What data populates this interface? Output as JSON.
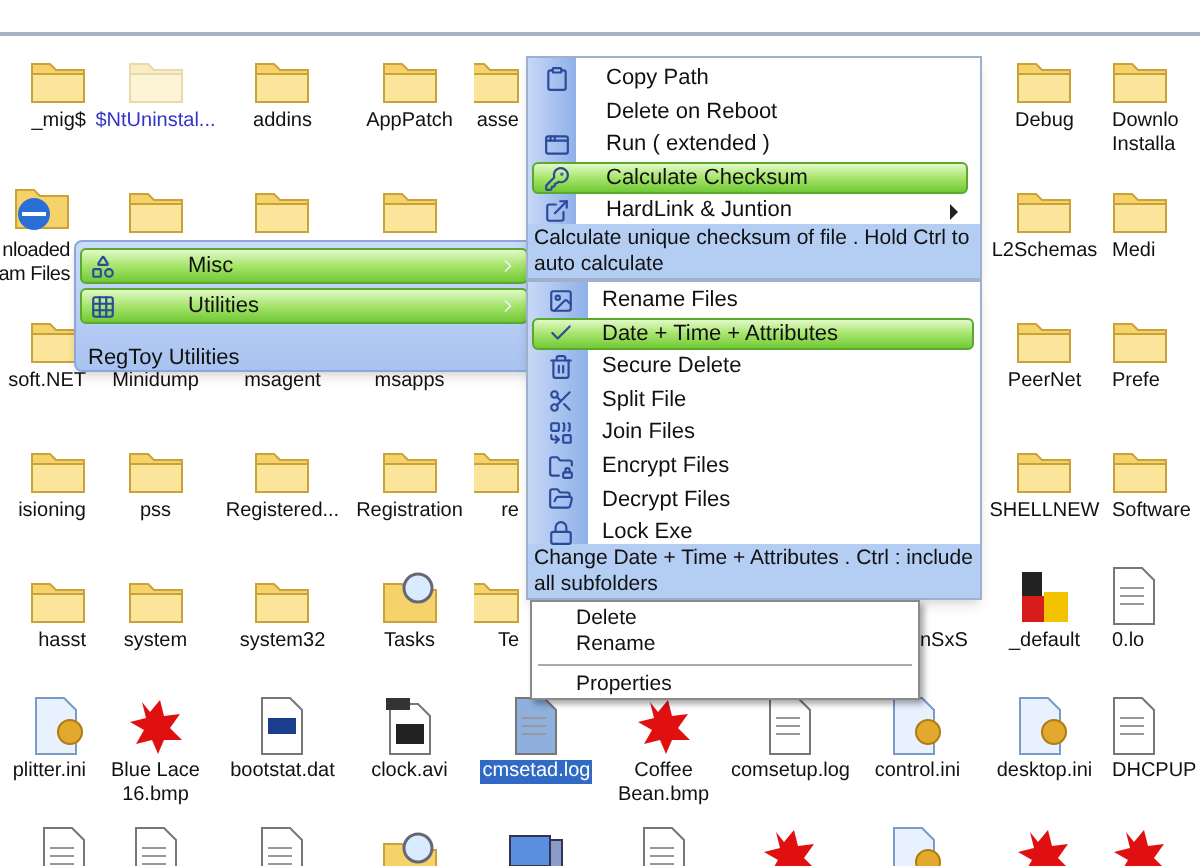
{
  "desktop": {
    "rows": [
      [
        {
          "kind": "folder",
          "label": "_mig$",
          "selected": false
        },
        {
          "kind": "folder-faded",
          "label": "$NtUninstal...",
          "selected": false,
          "color": "#3333cc"
        },
        {
          "kind": "folder",
          "label": "addins",
          "selected": false
        },
        {
          "kind": "folder",
          "label": "AppPatch",
          "selected": false
        },
        {
          "kind": "folder",
          "label": "asse",
          "selected": false
        },
        {
          "kind": "none"
        },
        {
          "kind": "none"
        },
        {
          "kind": "none"
        },
        {
          "kind": "folder",
          "label": "Debug",
          "selected": false
        },
        {
          "kind": "folder",
          "label": "Downlo\nInstalla",
          "selected": false
        }
      ],
      [
        {
          "kind": "folder-ie",
          "label": "nloaded\nam Files",
          "selected": false
        },
        {
          "kind": "folder"
        },
        {
          "kind": "folder"
        },
        {
          "kind": "folder"
        },
        {
          "kind": "none"
        },
        {
          "kind": "none"
        },
        {
          "kind": "none"
        },
        {
          "kind": "none"
        },
        {
          "kind": "folder",
          "label": "L2Schemas",
          "selected": false
        },
        {
          "kind": "folder",
          "label": "Medi",
          "selected": false
        }
      ],
      [
        {
          "kind": "folder",
          "label": "soft.NET",
          "selected": false
        },
        {
          "kind": "none",
          "label": "Minidump",
          "selected": false
        },
        {
          "kind": "none",
          "label": "msagent",
          "selected": false
        },
        {
          "kind": "none",
          "label": "msapps",
          "selected": false
        },
        {
          "kind": "none"
        },
        {
          "kind": "none"
        },
        {
          "kind": "none"
        },
        {
          "kind": "none"
        },
        {
          "kind": "folder",
          "label": "PeerNet",
          "selected": false
        },
        {
          "kind": "folder",
          "label": "Prefe",
          "selected": false
        }
      ],
      [
        {
          "kind": "folder",
          "label": "isioning",
          "selected": false
        },
        {
          "kind": "folder",
          "label": "pss",
          "selected": false
        },
        {
          "kind": "folder",
          "label": "Registered...",
          "selected": false
        },
        {
          "kind": "folder",
          "label": "Registration",
          "selected": false
        },
        {
          "kind": "folder",
          "label": "re",
          "selected": false
        },
        {
          "kind": "none"
        },
        {
          "kind": "none"
        },
        {
          "kind": "none"
        },
        {
          "kind": "folder",
          "label": "SHELLNEW",
          "selected": false
        },
        {
          "kind": "folder",
          "label": "Software",
          "selected": false
        }
      ],
      [
        {
          "kind": "folder",
          "label": "hasst",
          "selected": false
        },
        {
          "kind": "folder",
          "label": "system",
          "selected": false
        },
        {
          "kind": "folder",
          "label": "system32",
          "selected": false
        },
        {
          "kind": "folder-search",
          "label": "Tasks",
          "selected": false
        },
        {
          "kind": "folder",
          "label": "Te",
          "selected": false
        },
        {
          "kind": "none"
        },
        {
          "kind": "none"
        },
        {
          "kind": "none",
          "label": "nSxS",
          "selected": false
        },
        {
          "kind": "msi",
          "label": "_default",
          "selected": false
        },
        {
          "kind": "doc",
          "label": "0.lo",
          "selected": false
        }
      ],
      [
        {
          "kind": "settings-doc",
          "label": "plitter.ini",
          "selected": false
        },
        {
          "kind": "splat",
          "label": "Blue Lace\n16.bmp",
          "selected": false
        },
        {
          "kind": "dat",
          "label": "bootstat.dat",
          "selected": false
        },
        {
          "kind": "avi",
          "label": "clock.avi",
          "selected": false
        },
        {
          "kind": "log",
          "label": "cmsetad.log",
          "selected": true
        },
        {
          "kind": "splat",
          "label": "Coffee\nBean.bmp",
          "selected": false
        },
        {
          "kind": "doc",
          "label": "comsetup.log",
          "selected": false
        },
        {
          "kind": "settings-doc",
          "label": "control.ini",
          "selected": false
        },
        {
          "kind": "settings-doc",
          "label": "desktop.ini",
          "selected": false
        },
        {
          "kind": "doc",
          "label": "DHCPUP",
          "selected": false
        }
      ],
      [
        {
          "kind": "doc"
        },
        {
          "kind": "doc"
        },
        {
          "kind": "doc"
        },
        {
          "kind": "folder-search"
        },
        {
          "kind": "computer"
        },
        {
          "kind": "doc"
        },
        {
          "kind": "splat"
        },
        {
          "kind": "settings-doc"
        },
        {
          "kind": "splat"
        },
        {
          "kind": "splat"
        }
      ]
    ]
  },
  "regtoy_menu": {
    "items": [
      {
        "label": "Misc",
        "selected": true,
        "submenu": true
      },
      {
        "label": "Utilities",
        "selected": true,
        "submenu": true
      }
    ],
    "footer": "RegToy Utilities"
  },
  "file_menu": {
    "items": [
      {
        "label": "Copy Path",
        "selected": false,
        "submenu": false
      },
      {
        "label": "Delete on Reboot",
        "selected": false,
        "submenu": false
      },
      {
        "label": "Run ( extended )",
        "selected": false,
        "submenu": false
      },
      {
        "label": "Calculate Checksum",
        "selected": true,
        "submenu": false
      },
      {
        "label": "HardLink & Juntion",
        "selected": false,
        "submenu": true
      }
    ],
    "description": "Calculate unique checksum of file . Hold Ctrl to auto calculate"
  },
  "utilities_menu": {
    "items": [
      {
        "label": "Rename Files",
        "selected": false
      },
      {
        "label": "Date + Time + Attributes",
        "selected": true
      },
      {
        "label": "Secure Delete",
        "selected": false
      },
      {
        "label": "Split File",
        "selected": false
      },
      {
        "label": "Join Files",
        "selected": false
      },
      {
        "label": "Encrypt Files",
        "selected": false
      },
      {
        "label": "Decrypt Files",
        "selected": false
      },
      {
        "label": "Lock Exe",
        "selected": false
      }
    ],
    "description": "Change Date + Time + Attributes . Ctrl : include all subfolders"
  },
  "context_menu": {
    "items": [
      {
        "kind": "item",
        "label": "Delete"
      },
      {
        "kind": "item",
        "label": "Rename"
      },
      {
        "kind": "separator"
      },
      {
        "kind": "item",
        "label": "Properties"
      }
    ]
  }
}
